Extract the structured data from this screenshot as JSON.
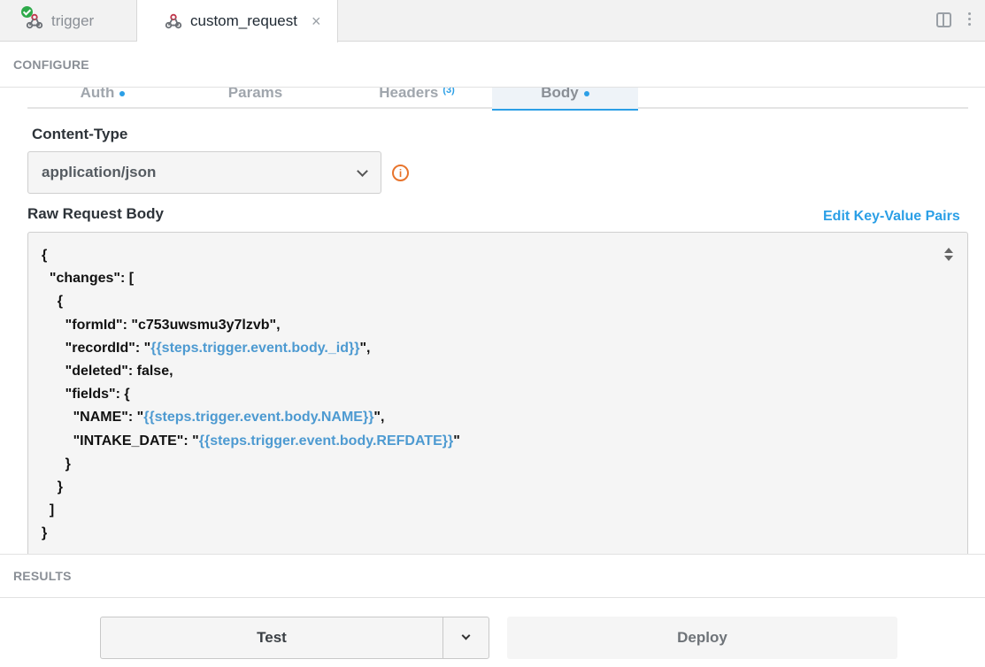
{
  "tabs": [
    {
      "label": "trigger",
      "icon": "webhook-icon",
      "status": "success"
    },
    {
      "label": "custom_request",
      "icon": "webhook-icon",
      "close": "×"
    }
  ],
  "sections": {
    "configure": "CONFIGURE",
    "results": "RESULTS"
  },
  "request_tabs": [
    {
      "label": "Auth",
      "indicator": "dot"
    },
    {
      "label": "Params"
    },
    {
      "label": "Headers",
      "count": "(3)"
    },
    {
      "label": "Body",
      "indicator": "dot",
      "active": true
    }
  ],
  "content_type": {
    "label": "Content-Type",
    "value": "application/json"
  },
  "raw_body": {
    "label": "Raw Request Body",
    "edit_link": "Edit Key-Value Pairs",
    "lines": [
      "{",
      "  \"changes\": [",
      "    {",
      "      \"formId\": \"c753uwsmu3y7lzvb\",",
      "      \"recordId\": \"{{steps.trigger.event.body._id}}\",",
      "      \"deleted\": false,",
      "      \"fields\": {",
      "        \"NAME\": \"{{steps.trigger.event.body.NAME}}\",",
      "        \"INTAKE_DATE\": \"{{steps.trigger.event.body.REFDATE}}\"",
      "      }",
      "    }",
      "  ]",
      "}"
    ]
  },
  "footer": {
    "test_label": "Test",
    "deploy_label": "Deploy"
  },
  "colors": {
    "accent": "#2b9fe6",
    "warning": "#e8742c",
    "success": "#2eaa4a",
    "template_var": "#4d9ad1"
  }
}
